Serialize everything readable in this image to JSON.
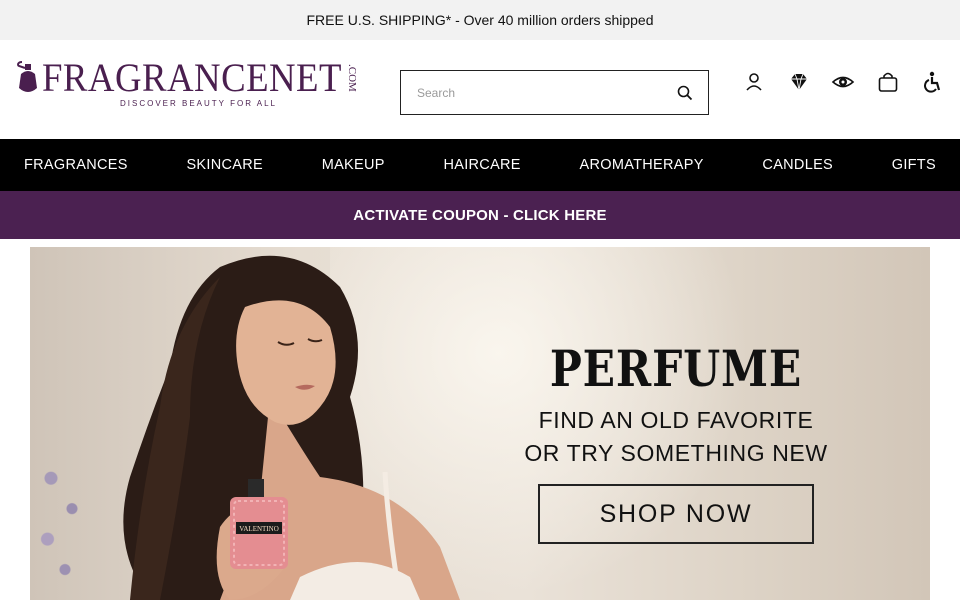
{
  "promo": {
    "text": "FREE U.S. SHIPPING* - Over 40 million orders shipped"
  },
  "header": {
    "logo_text": "FRAGRANCENET",
    "logo_com": ".COM",
    "logo_tagline": "DISCOVER BEAUTY FOR ALL",
    "search_placeholder": "Search",
    "icons": [
      "account-icon",
      "rewards-diamond-icon",
      "accessibility-eye-icon",
      "shopping-bag-icon",
      "accessibility-icon"
    ]
  },
  "nav": {
    "items": [
      "FRAGRANCES",
      "SKINCARE",
      "MAKEUP",
      "HAIRCARE",
      "AROMATHERAPY",
      "CANDLES",
      "GIFTS"
    ]
  },
  "coupon": {
    "text": "ACTIVATE COUPON - CLICK HERE"
  },
  "hero": {
    "title": "PERFUME",
    "line1": "FIND AN OLD FAVORITE",
    "line2": "OR TRY SOMETHING NEW",
    "button": "SHOP NOW",
    "bottle_label": "VALENTINO"
  },
  "colors": {
    "brand_purple": "#4b2151",
    "nav_bg": "#000000",
    "promo_bg": "#f2f2f2"
  }
}
